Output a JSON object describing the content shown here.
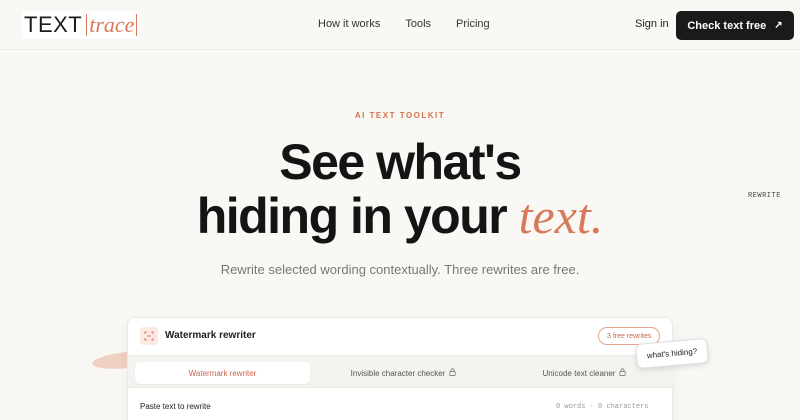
{
  "brand": {
    "logo_main": "TEXT",
    "logo_accent": "trace"
  },
  "nav": {
    "links": [
      "How it works",
      "Tools",
      "Pricing"
    ],
    "signin": "Sign in",
    "cta_label": "Check text free",
    "cta_icon": "arrow-up-right-icon"
  },
  "hero": {
    "eyebrow": "AI TEXT TOOLKIT",
    "line1": "See what's",
    "line2": "hiding in your",
    "accent": "text.",
    "subhead": "Rewrite selected wording contextually. Three rewrites are free.",
    "side_tag": "REWRITE"
  },
  "card": {
    "title": "Watermark rewriter",
    "badge": "3 free rewrites",
    "tabs": [
      {
        "label": "Watermark rewriter",
        "active": true,
        "locked": false
      },
      {
        "label": "Invisible character checker",
        "active": false,
        "locked": true
      },
      {
        "label": "Unicode text cleaner",
        "active": false,
        "locked": true
      }
    ],
    "paste_label": "Paste text to rewrite",
    "counts": "0 words · 0 characters"
  },
  "bubble": "what's hiding?",
  "colors": {
    "accent": "#d77a5c",
    "dark": "#1a1a1a",
    "background": "#faf8f5"
  }
}
